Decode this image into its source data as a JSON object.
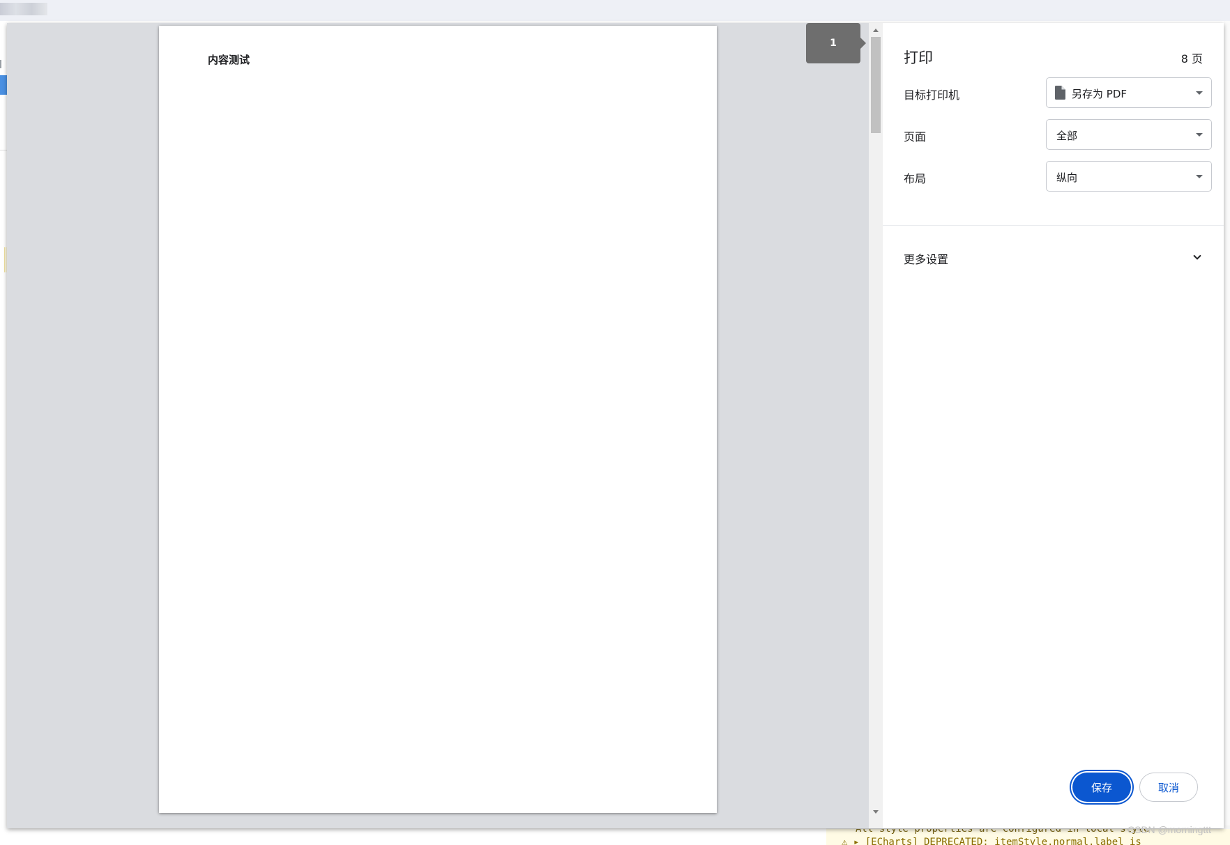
{
  "preview": {
    "page_badge": "1",
    "content_text": "内容测试"
  },
  "sidebar": {
    "title": "打印",
    "page_count": "8 页",
    "destination_label": "目标打印机",
    "destination_value": "另存为 PDF",
    "pages_label": "页面",
    "pages_value": "全部",
    "layout_label": "布局",
    "layout_value": "纵向",
    "more_settings_label": "更多设置",
    "save_label": "保存",
    "cancel_label": "取消"
  },
  "background": {
    "console_line1": "All style properties are configured in local style",
    "console_line2": "⚠ ▸ [ECharts] DEPRECATED: itemStyle.normal.label is"
  },
  "watermark": "CSDN @morningttt",
  "colors": {
    "primary": "#0b57d0",
    "preview_bg": "#dadce0",
    "badge_bg": "#6e6e6e"
  }
}
